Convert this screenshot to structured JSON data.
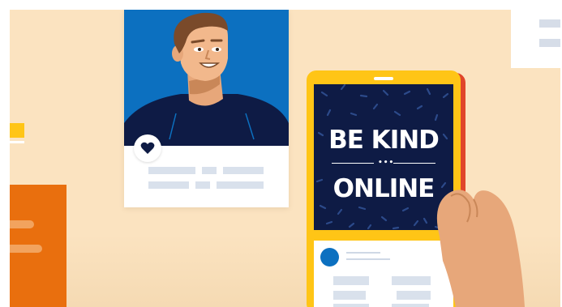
{
  "scene": {
    "headline": {
      "line1": "BE KIND",
      "dots": "•••",
      "line2": "ONLINE"
    },
    "icons": {
      "like": "heart-icon",
      "avatar": "avatar-icon"
    },
    "colors": {
      "background": "#fbe3c0",
      "accent_blue": "#0c70c0",
      "screen_navy": "#0e1b45",
      "phone_yellow": "#ffc516",
      "phone_red": "#e0452a",
      "orange": "#e96f0e",
      "placeholder_gray": "#d9e1ec"
    }
  }
}
